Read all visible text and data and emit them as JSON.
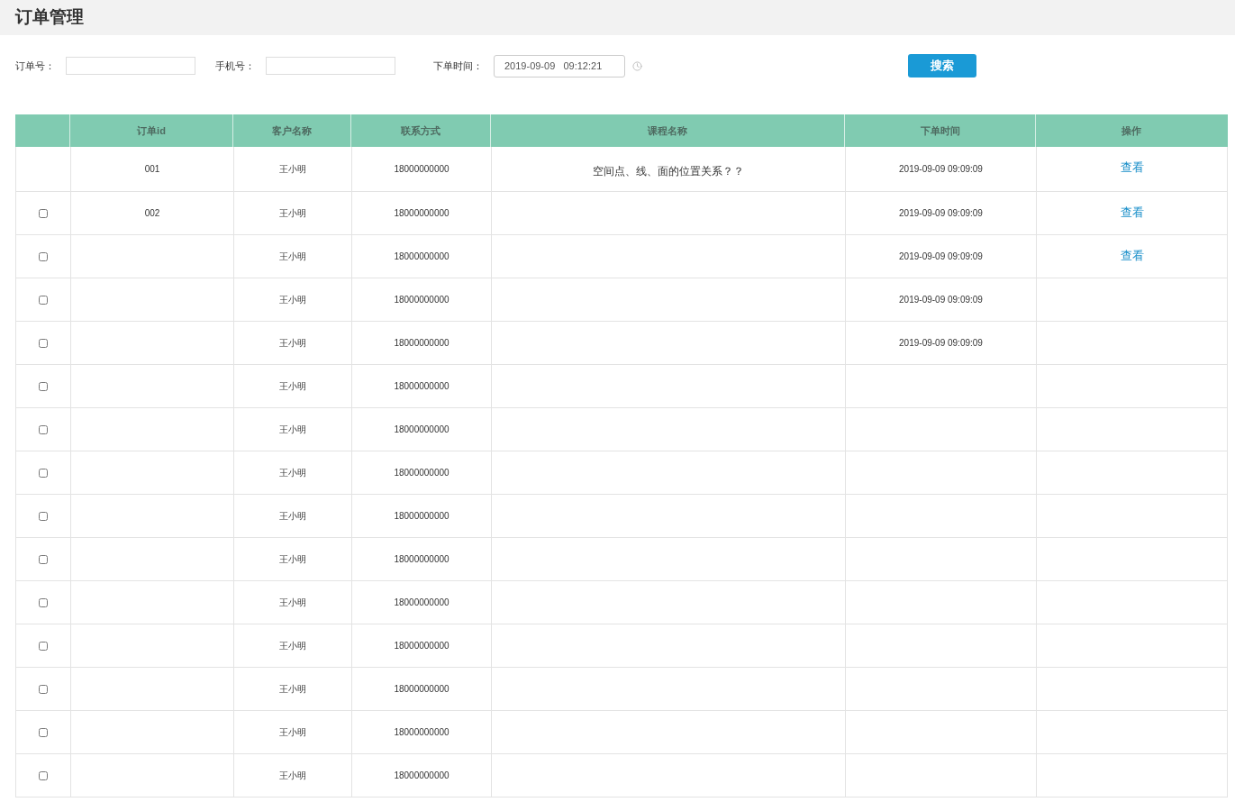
{
  "title": "订单管理",
  "filters": [
    {
      "label": "订单号：",
      "kind": "text"
    },
    {
      "label": "手机号：",
      "kind": "text"
    },
    {
      "label": "下单时间：",
      "kind": "datetime",
      "value": "2019-09-09   09:12:21"
    }
  ],
  "search_button": "搜索",
  "table": {
    "columns": [
      "",
      "订单id",
      "客户名称",
      "联系方式",
      "课程名称",
      "下单时间",
      "操作"
    ],
    "rows": [
      {
        "id": "001",
        "customer": "王小明",
        "phone": "18000000000",
        "course": "空间点、线、面的位置关系？？",
        "time": "2019-09-09 09:09:09",
        "action": "查看"
      },
      {
        "checked": false,
        "id": "002",
        "customer": "王小明",
        "phone": "18000000000",
        "time": "2019-09-09 09:09:09",
        "action": "查看"
      },
      {
        "checked": false,
        "customer": "王小明",
        "phone": "18000000000",
        "time": "2019-09-09 09:09:09",
        "action": "查看"
      },
      {
        "checked": false,
        "customer": "王小明",
        "phone": "18000000000",
        "time": "2019-09-09 09:09:09"
      },
      {
        "checked": false,
        "customer": "王小明",
        "phone": "18000000000",
        "time": "2019-09-09 09:09:09"
      },
      {
        "checked": false,
        "customer": "王小明",
        "phone": "18000000000"
      },
      {
        "checked": false,
        "customer": "王小明",
        "phone": "18000000000"
      },
      {
        "checked": false,
        "customer": "王小明",
        "phone": "18000000000"
      },
      {
        "checked": false,
        "customer": "王小明",
        "phone": "18000000000"
      },
      {
        "checked": false,
        "customer": "王小明",
        "phone": "18000000000"
      },
      {
        "checked": false,
        "customer": "王小明",
        "phone": "18000000000"
      },
      {
        "checked": false,
        "customer": "王小明",
        "phone": "18000000000"
      },
      {
        "checked": false,
        "customer": "王小明",
        "phone": "18000000000"
      },
      {
        "checked": false,
        "customer": "王小明",
        "phone": "18000000000"
      },
      {
        "checked": false,
        "customer": "王小明",
        "phone": "18000000000"
      }
    ]
  }
}
